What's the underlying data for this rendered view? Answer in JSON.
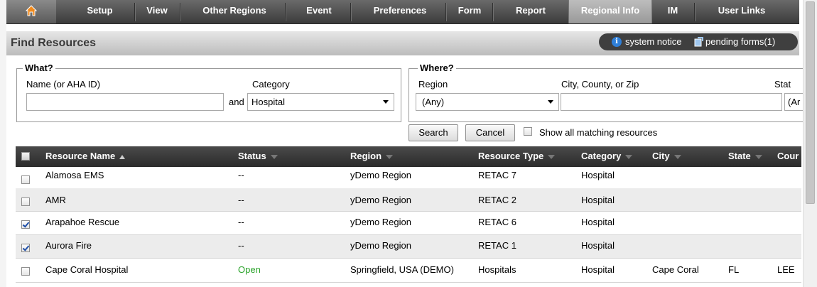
{
  "nav": {
    "items": [
      "Setup",
      "View",
      "Other Regions",
      "Event",
      "Preferences",
      "Form",
      "Report",
      "Regional Info",
      "IM",
      "User Links"
    ],
    "active": "Regional Info"
  },
  "page": {
    "title": "Find Resources",
    "system_notice": "system notice",
    "pending_forms": "pending forms(1)"
  },
  "what": {
    "legend": "What?",
    "name_label": "Name (or AHA ID)",
    "name_value": "",
    "and_label": "and",
    "category_label": "Category",
    "category_value": "Hospital"
  },
  "where": {
    "legend": "Where?",
    "region_label": "Region",
    "region_value": "(Any)",
    "city_label": "City, County, or Zip",
    "city_value": "",
    "state_label": "Stat",
    "state_value": "(Ar"
  },
  "actions": {
    "search": "Search",
    "cancel": "Cancel",
    "show_all": "Show all matching resources"
  },
  "table": {
    "columns": [
      "Resource Name",
      "Status",
      "Region",
      "Resource Type",
      "Category",
      "City",
      "State",
      "Cour"
    ],
    "rows": [
      {
        "checked": false,
        "name": "Alamosa EMS",
        "status": "--",
        "region": "yDemo Region",
        "type": "RETAC 7",
        "category": "Hospital",
        "city": "",
        "state": "",
        "county": ""
      },
      {
        "checked": false,
        "name": "AMR",
        "status": "--",
        "region": "yDemo Region",
        "type": "RETAC 2",
        "category": "Hospital",
        "city": "",
        "state": "",
        "county": ""
      },
      {
        "checked": true,
        "name": "Arapahoe Rescue",
        "status": "--",
        "region": "yDemo Region",
        "type": "RETAC 6",
        "category": "Hospital",
        "city": "",
        "state": "",
        "county": ""
      },
      {
        "checked": true,
        "name": "Aurora Fire",
        "status": "--",
        "region": "yDemo Region",
        "type": "RETAC 1",
        "category": "Hospital",
        "city": "",
        "state": "",
        "county": ""
      },
      {
        "checked": false,
        "name": "Cape Coral Hospital",
        "status": "Open",
        "region": "Springfield, USA (DEMO)",
        "type": "Hospitals",
        "category": "Hospital",
        "city": "Cape Coral",
        "state": "FL",
        "county": "LEE"
      }
    ]
  }
}
